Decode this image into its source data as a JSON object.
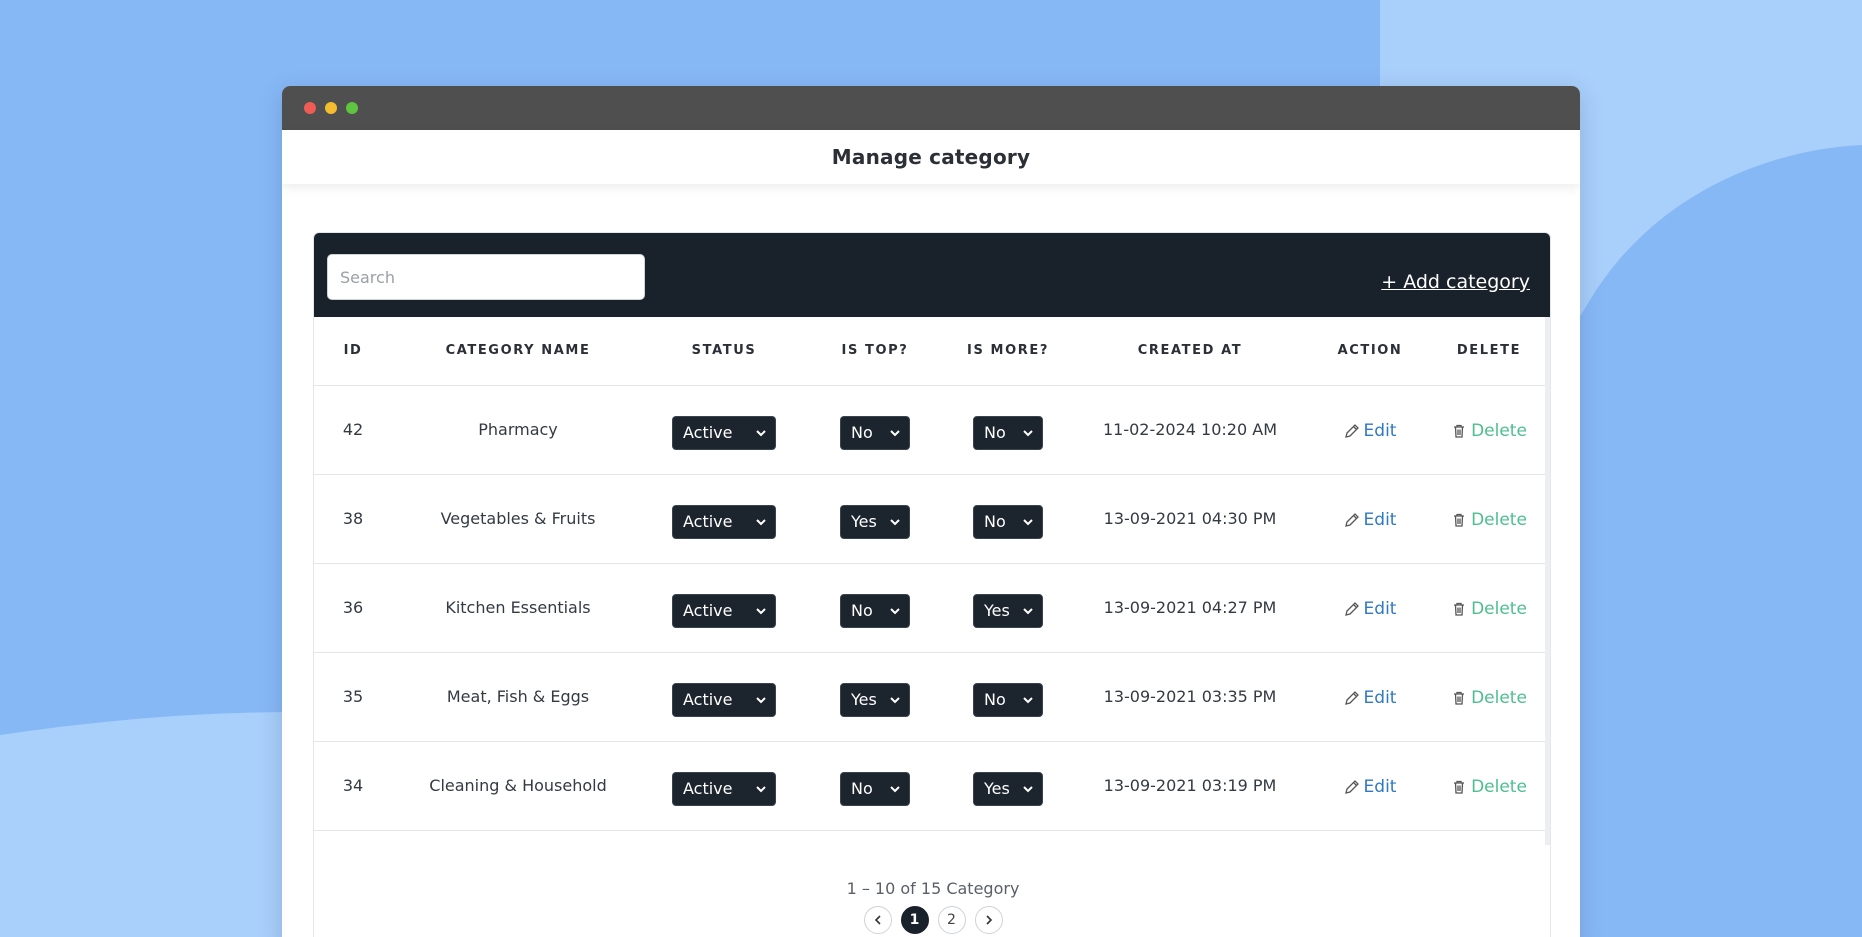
{
  "header": {
    "title": "Manage category"
  },
  "toolbar": {
    "search_placeholder": "Search",
    "add_label": "+ Add category"
  },
  "columns": [
    "ID",
    "CATEGORY NAME",
    "STATUS",
    "IS TOP?",
    "IS MORE?",
    "CREATED AT",
    "ACTION",
    "DELETE"
  ],
  "rows": [
    {
      "id": "42",
      "name": "Pharmacy",
      "status": "Active",
      "is_top": "No",
      "is_more": "No",
      "created_at": "11-02-2024 10:20 AM",
      "edit": "Edit",
      "delete": "Delete"
    },
    {
      "id": "38",
      "name": "Vegetables & Fruits",
      "status": "Active",
      "is_top": "Yes",
      "is_more": "No",
      "created_at": "13-09-2021 04:30 PM",
      "edit": "Edit",
      "delete": "Delete"
    },
    {
      "id": "36",
      "name": "Kitchen Essentials",
      "status": "Active",
      "is_top": "No",
      "is_more": "Yes",
      "created_at": "13-09-2021 04:27 PM",
      "edit": "Edit",
      "delete": "Delete"
    },
    {
      "id": "35",
      "name": "Meat, Fish & Eggs",
      "status": "Active",
      "is_top": "Yes",
      "is_more": "No",
      "created_at": "13-09-2021 03:35 PM",
      "edit": "Edit",
      "delete": "Delete"
    },
    {
      "id": "34",
      "name": "Cleaning & Household",
      "status": "Active",
      "is_top": "No",
      "is_more": "Yes",
      "created_at": "13-09-2021 03:19 PM",
      "edit": "Edit",
      "delete": "Delete"
    }
  ],
  "pagination": {
    "range_text": "1 – 10 of 15 Category",
    "pages": [
      "1",
      "2"
    ],
    "current": "1"
  },
  "colors": {
    "toolbar_bg": "#19212a",
    "edit": "#2e79c4",
    "delete": "#4cbf8f",
    "page_bg": "#87b8f6"
  }
}
